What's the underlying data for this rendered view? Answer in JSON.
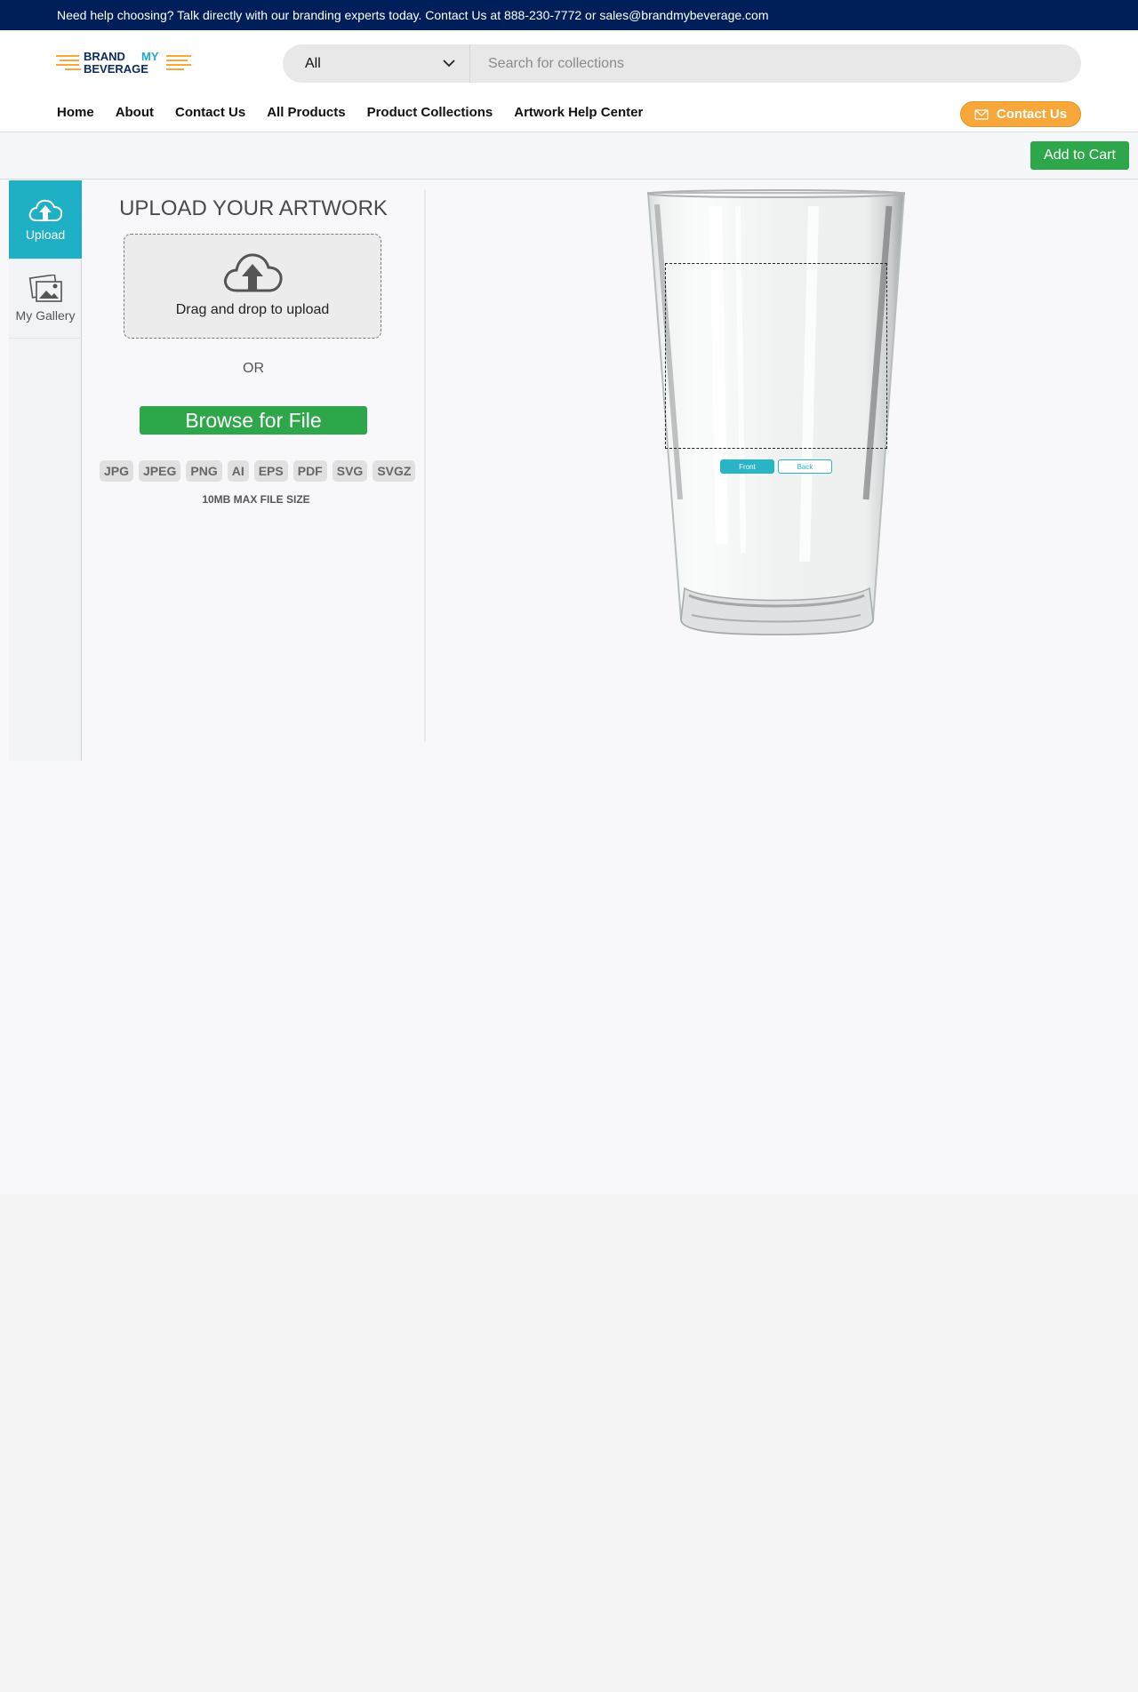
{
  "topbar": {
    "text": "Need help choosing? Talk directly with our branding experts today. Contact Us at 888-230-7772 or sales@brandmybeverage.com"
  },
  "header": {
    "logo": {
      "line1a": "BRAND",
      "line1b": "MY",
      "line2": "BEVERAGE"
    },
    "search": {
      "category": "All",
      "placeholder": "Search for collections"
    },
    "nav": [
      "Home",
      "About",
      "Contact Us",
      "All Products",
      "Product Collections",
      "Artwork Help Center"
    ],
    "contact_button": "Contact Us"
  },
  "actionbar": {
    "add_to_cart": "Add to Cart"
  },
  "sidebar": {
    "tabs": [
      {
        "label": "Upload",
        "icon": "cloud-upload-icon",
        "active": true
      },
      {
        "label": "My Gallery",
        "icon": "gallery-icon",
        "active": false
      }
    ]
  },
  "upload": {
    "title": "UPLOAD YOUR ARTWORK",
    "dropzone_text": "Drag and drop to upload",
    "or": "OR",
    "browse": "Browse for File",
    "formats": [
      "JPG",
      "JPEG",
      "PNG",
      "AI",
      "EPS",
      "PDF",
      "SVG",
      "SVGZ"
    ],
    "max_size": "10MB MAX FILE SIZE"
  },
  "preview": {
    "front": "Front",
    "back": "Back"
  },
  "colors": {
    "topbar": "#001e5a",
    "teal": "#1fb0c5",
    "green": "#2ea64a",
    "orange": "#f8a83b"
  }
}
